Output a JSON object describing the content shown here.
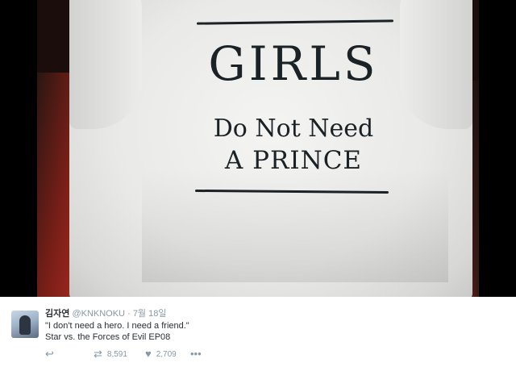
{
  "shirt_print": {
    "line1": "GIRLS",
    "line2": "Do Not Need",
    "line3": "A PRINCE"
  },
  "tweet": {
    "display_name": "김자연",
    "handle": "@KNKNOKU",
    "separator": "·",
    "date": "7월 18일",
    "text_line1": "\"I don't need a hero. I need a friend.\"",
    "text_line2": "Star vs. the Forces of Evil EP08",
    "retweets": "8,591",
    "likes": "2,709"
  },
  "icons": {
    "reply": "reply-icon",
    "retweet": "retweet-icon",
    "like": "heart-icon",
    "more": "more-icon"
  },
  "colors": {
    "text": "#292f33",
    "muted": "#8899a6",
    "print": "#1b2225"
  }
}
